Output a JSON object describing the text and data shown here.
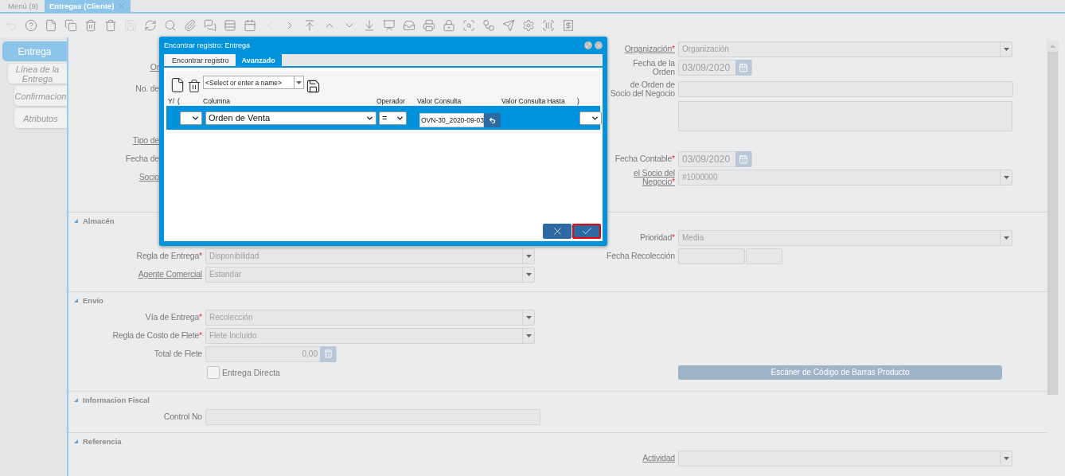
{
  "window_tabs": [
    {
      "label": "Menú (9)",
      "selected": false,
      "closable": false
    },
    {
      "label": "Entregas (Cliente)",
      "selected": true,
      "closable": true
    }
  ],
  "toolbar": [
    {
      "kind": "undo",
      "disabled": true
    },
    {
      "kind": "help",
      "disabled": false
    },
    {
      "kind": "new",
      "disabled": false
    },
    {
      "kind": "copy",
      "disabled": false
    },
    {
      "kind": "delete",
      "disabled": false
    },
    {
      "kind": "delete_selection",
      "disabled": false
    },
    {
      "kind": "save",
      "disabled": true
    },
    {
      "kind": "refresh",
      "disabled": false
    },
    {
      "kind": "find",
      "disabled": false
    },
    {
      "kind": "attachment",
      "disabled": false
    },
    {
      "kind": "chat",
      "disabled": false
    },
    {
      "kind": "grid",
      "disabled": false
    },
    {
      "kind": "calendar",
      "disabled": false
    },
    {
      "kind": "previous",
      "disabled": true
    },
    {
      "kind": "next",
      "disabled": false
    },
    {
      "kind": "first",
      "disabled": false
    },
    {
      "kind": "up",
      "disabled": false
    },
    {
      "kind": "down",
      "disabled": false
    },
    {
      "kind": "last",
      "disabled": false
    },
    {
      "kind": "report",
      "disabled": false
    },
    {
      "kind": "archive",
      "disabled": false
    },
    {
      "kind": "print",
      "disabled": false
    },
    {
      "kind": "lock",
      "disabled": false
    },
    {
      "kind": "zoom_across",
      "disabled": false
    },
    {
      "kind": "workflow",
      "disabled": false
    },
    {
      "kind": "send",
      "disabled": false
    },
    {
      "kind": "settings",
      "disabled": false
    },
    {
      "kind": "barcode",
      "disabled": false
    },
    {
      "kind": "receipt",
      "disabled": false
    }
  ],
  "side_tabs": [
    {
      "label": "Entrega",
      "selected": true,
      "children": [
        {
          "label": "Línea de la Entrega",
          "selected": false,
          "children": [
            {
              "label": "Confirmacion",
              "selected": false
            },
            {
              "label": "Atributos",
              "selected": false
            }
          ]
        }
      ]
    }
  ],
  "form": {
    "sections": [
      {
        "rows": [
          {
            "right": {
              "label": "Organización",
              "required_mark": "*",
              "link": true,
              "kind": "select",
              "value": "Organización"
            }
          },
          {
            "left": {
              "label": "Or",
              "link": true,
              "kind": "hidden"
            },
            "right": {
              "label": "Fecha de la Orden",
              "kind": "date",
              "value": "03/09/2020"
            }
          },
          {
            "left": {
              "label": "No. de",
              "kind": "hidden"
            },
            "right": {
              "label": "de Orden de Socio del Negocio",
              "kind": "text"
            }
          },
          {
            "right": {
              "kind": "textarea"
            }
          },
          {
            "left": {
              "label": "Tipo de",
              "link": true,
              "kind": "hidden"
            }
          },
          {
            "left": {
              "label": "Fecha de",
              "kind": "hidden"
            },
            "right": {
              "label": "Fecha Contable",
              "required_mark": "*",
              "kind": "date",
              "value": "03/09/2020"
            }
          },
          {
            "left": {
              "label": "Socio",
              "link": true,
              "kind": "hidden"
            },
            "right": {
              "label": "el Socio del Negocio",
              "required_mark": "*",
              "link": true,
              "kind": "select",
              "value": "#1000000"
            }
          }
        ]
      },
      {
        "title": "Almacén",
        "expanded": true,
        "rows": [
          {
            "right": {
              "label": "Prioridad",
              "required_mark": "*",
              "kind": "select",
              "value": "Media"
            }
          },
          {
            "left": {
              "label": "Regla de Entrega",
              "required_mark": "*",
              "kind": "select",
              "value": "Disponibilidad"
            },
            "right": {
              "label": "Fecha Recolección",
              "kind": "datetime"
            }
          },
          {
            "left": {
              "label": "Agente Comercial",
              "link": true,
              "kind": "select",
              "value": "Estandar"
            }
          }
        ]
      },
      {
        "title": "Envío",
        "expanded": true,
        "rows": [
          {
            "left": {
              "label": "Vía de Entrega",
              "required_mark": "*",
              "kind": "select",
              "value": "Recolección"
            }
          },
          {
            "left": {
              "label": "Regla de Costo de Flete",
              "required_mark": "*",
              "kind": "select",
              "value": "Flete Incluido"
            }
          },
          {
            "left": {
              "label": "Total de Flete",
              "kind": "number",
              "value": "0,00"
            }
          },
          {
            "left": {
              "label": "Entrega Directa",
              "kind": "checkbox",
              "checked": false
            },
            "right": {
              "label": "Escáner de Código de Barras Producto",
              "kind": "button",
              "disabled": true
            }
          }
        ]
      },
      {
        "title": "Informacion Fiscal",
        "expanded": true,
        "rows": [
          {
            "left": {
              "label": "Control No",
              "kind": "text"
            }
          }
        ]
      },
      {
        "title": "Referencia",
        "expanded": true,
        "rows": [
          {
            "right": {
              "label": "Actividad",
              "link": true,
              "kind": "select"
            }
          }
        ]
      }
    ]
  },
  "dialog": {
    "title": "Encontrar registro: Entrega",
    "tabs": [
      {
        "label": "Encontrar registro",
        "selected": false
      },
      {
        "label": "Avanzado",
        "selected": true
      }
    ],
    "query_name": {
      "placeholder": "<Select or enter a name>"
    },
    "columns": [
      "Y/",
      "(",
      "Columna",
      "Operador",
      "Valor Consulta",
      "Valor Consulta Hasta",
      ")"
    ],
    "rows": [
      {
        "column": "Orden de Venta",
        "operator": "=",
        "value": "OVN-30_2020-09-03",
        "selected": true
      }
    ],
    "buttons": [
      {
        "kind": "cancel",
        "highlighted": false
      },
      {
        "kind": "ok",
        "highlighted": true
      }
    ]
  }
}
